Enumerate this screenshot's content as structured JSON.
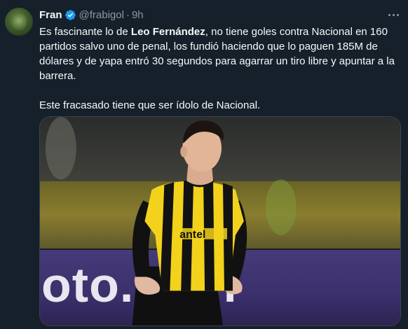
{
  "author": {
    "name": "Fran",
    "handle": "@frabigol",
    "separator": "·",
    "time": "9h"
  },
  "tweet": {
    "p1_before": "Es fascinante lo de ",
    "p1_bold": "Leo Fernández",
    "p1_after": ", no tiene goles contra Nacional en 160 partidos salvo uno de penal, los fundió haciendo que lo paguen 185M de dólares y de yapa entró 30 segundos para agarrar un tiro libre y apuntar a la barrera.",
    "p2": "Este fracasado tiene que ser ídolo de Nacional."
  },
  "media": {
    "jersey_sponsor": "antel",
    "board_text": "oto.com"
  },
  "colors": {
    "background": "#15202b",
    "verified": "#1d9bf0",
    "muted": "#8b98a5",
    "jersey_yellow": "#f2d21b",
    "jersey_black": "#121212"
  },
  "icons": [
    "verified-badge-icon",
    "more-options-icon"
  ]
}
